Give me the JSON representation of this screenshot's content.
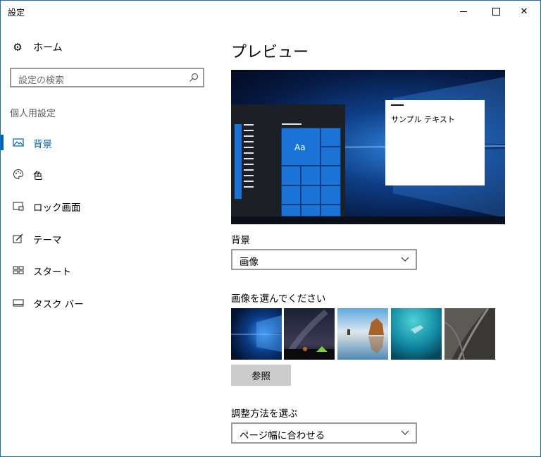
{
  "window": {
    "title": "設定"
  },
  "sidebar": {
    "home_label": "ホーム",
    "search_placeholder": "設定の検索",
    "section_label": "個人用設定",
    "items": [
      {
        "label": "背景",
        "icon": "picture-icon",
        "active": true
      },
      {
        "label": "色",
        "icon": "palette-icon",
        "active": false
      },
      {
        "label": "ロック画面",
        "icon": "lock-screen-icon",
        "active": false
      },
      {
        "label": "テーマ",
        "icon": "theme-brush-icon",
        "active": false
      },
      {
        "label": "スタート",
        "icon": "start-tiles-icon",
        "active": false
      },
      {
        "label": "タスク バー",
        "icon": "taskbar-icon",
        "active": false
      }
    ]
  },
  "main": {
    "title": "プレビュー",
    "preview": {
      "tile_text": "Aa",
      "sample_text": "サンプル テキスト"
    },
    "background_label": "背景",
    "background_value": "画像",
    "choose_picture_label": "画像を選んでください",
    "browse_label": "参照",
    "fit_label": "調整方法を選ぶ",
    "fit_value": "ページ幅に合わせる"
  },
  "colors": {
    "accent": "#0063b1",
    "border": "#9a9a9a",
    "button": "#cccccc"
  }
}
